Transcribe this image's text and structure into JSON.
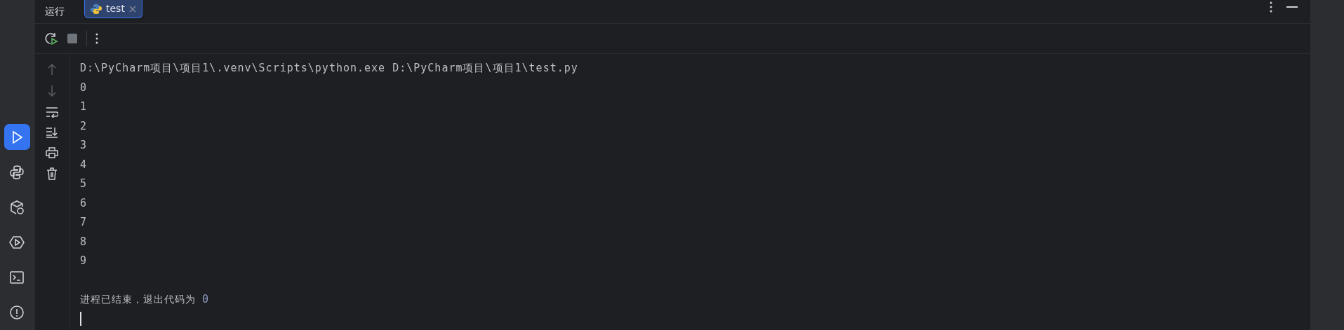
{
  "panel": {
    "title": "运行"
  },
  "tabs": [
    {
      "label": "test",
      "selected": true
    }
  ],
  "console": {
    "command": "D:\\PyCharm项目\\项目1\\.venv\\Scripts\\python.exe D:\\PyCharm项目\\项目1\\test.py",
    "output": [
      "0",
      "1",
      "2",
      "3",
      "4",
      "5",
      "6",
      "7",
      "8",
      "9"
    ],
    "exit_message": "进程已结束，退出代码为",
    "exit_code": "0"
  },
  "sidebar": {
    "items": [
      {
        "kind": "run",
        "selected": true
      },
      {
        "kind": "python",
        "selected": false
      },
      {
        "kind": "packages",
        "selected": false
      },
      {
        "kind": "services",
        "selected": false
      },
      {
        "kind": "terminal",
        "selected": false
      },
      {
        "kind": "problems",
        "selected": false
      }
    ]
  }
}
